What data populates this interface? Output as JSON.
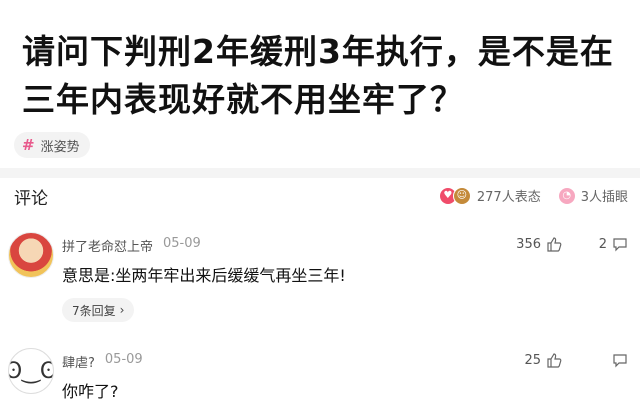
{
  "post": {
    "title": "请问下判刑2年缓刑3年执行，是不是在三年内表现好就不用坐牢了？",
    "tag": "涨姿势",
    "tag_icon": "hash-icon"
  },
  "comments_section": {
    "header": "评论",
    "reaction_count": "277人表态",
    "watch_count": "3人插眼"
  },
  "comments": [
    {
      "username": "拼了老命怼上帝",
      "date": "05-09",
      "likes": "356",
      "reply_count": "2",
      "text": "意思是:坐两年牢出来后缓缓气再坐三年!",
      "more_replies": "7条回复"
    },
    {
      "username": "肆虐?",
      "date": "05-09",
      "likes": "25",
      "reply_count": "",
      "text": "你咋了?"
    }
  ]
}
